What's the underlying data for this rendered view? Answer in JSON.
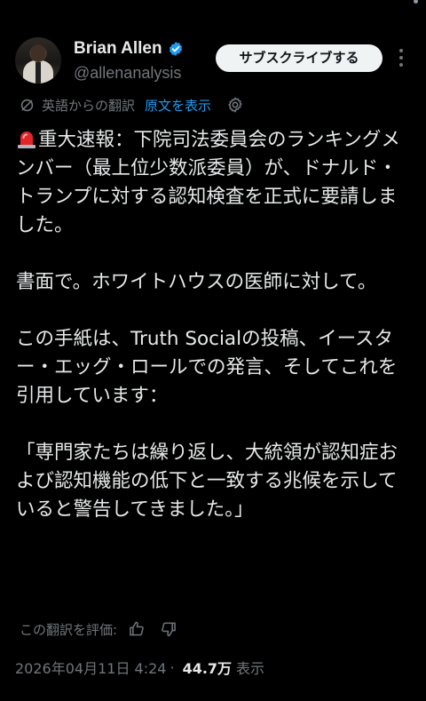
{
  "top": {
    "fragment": "・・・"
  },
  "author": {
    "name": "Brian Allen",
    "handle": "@allenanalysis",
    "subscribe_label": "サブスクライブする"
  },
  "translation": {
    "note": "英語からの翻訳",
    "show_original": "原文を表示"
  },
  "tweet": {
    "paragraphs": [
      "重大速報：下院司法委員会のランキングメンバー（最上位少数派委員）が、ドナルド・トランプに対する認知検査を正式に要請しました。",
      "書面で。ホワイトハウスの医師に対して。",
      "この手紙は、Truth Socialの投稿、イースター・エッグ・ロールでの発言、そしてこれを引用しています：",
      "「専門家たちは繰り返し、大統領が認知症および認知機能の低下と一致する兆候を示していると警告してきました。」"
    ]
  },
  "rating": {
    "label": "この翻訳を評価:"
  },
  "meta": {
    "datetime": "2026年04月11日 4:24",
    "separator": "·",
    "views": "44.7万",
    "views_label": "表示"
  },
  "icons": {
    "verified": "verified-badge-icon",
    "translate": "translate-icon",
    "settings": "gear-icon",
    "siren": "siren-emoji-icon",
    "thumbs_up": "thumbs-up-icon",
    "thumbs_down": "thumbs-down-icon",
    "more": "more-vertical-icon"
  },
  "colors": {
    "background": "#000000",
    "text": "#e7e9ea",
    "secondary": "#71767b",
    "link": "#1d9bf0",
    "verified": "#1d9bf0",
    "button_bg": "#eff3f4"
  }
}
